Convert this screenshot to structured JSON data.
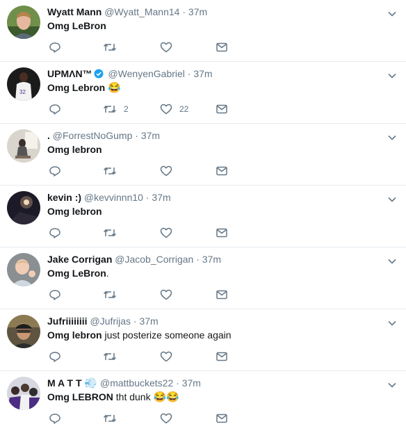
{
  "colors": {
    "text": "#14171a",
    "secondary": "#657786",
    "divider": "#e6ecf0",
    "verified": "#1da1f2"
  },
  "icons": [
    "reply-icon",
    "retweet-icon",
    "like-icon",
    "dm-icon",
    "chevron-down-icon",
    "verified-icon"
  ],
  "tweets": [
    {
      "name": "Wyatt Mann",
      "handle": "@Wyatt_Mann14",
      "time": "37m",
      "text_bold": "Omg LeBron",
      "text_rest": "",
      "emoji": "",
      "retweets": "",
      "likes": ""
    },
    {
      "name": "UPMΛN™",
      "handle": "@WenyenGabriel",
      "time": "37m",
      "text_bold": "Omg Lebron",
      "text_rest": "",
      "emoji": "😂",
      "retweets": "2",
      "likes": "22"
    },
    {
      "name": ".",
      "handle": "@ForrestNoGump",
      "time": "37m",
      "text_bold": "Omg lebron",
      "text_rest": "",
      "emoji": "",
      "retweets": "",
      "likes": ""
    },
    {
      "name": "kevin :)",
      "handle": "@kevvinnn10",
      "time": "37m",
      "text_bold": "Omg lebron",
      "text_rest": "",
      "emoji": "",
      "retweets": "",
      "likes": ""
    },
    {
      "name": "Jake Corrigan",
      "handle": "@Jacob_Corrigan",
      "time": "37m",
      "text_bold": "Omg LeBron",
      "text_rest": ".",
      "emoji": "",
      "retweets": "",
      "likes": ""
    },
    {
      "name": "Jufriiiiiiii",
      "handle": "@Jufrijas",
      "time": "37m",
      "text_bold": "Omg lebron",
      "text_rest": " just posterize someone again",
      "emoji": "",
      "retweets": "",
      "likes": ""
    },
    {
      "name": "M A T T",
      "name_emoji": "💨",
      "handle": "@mattbuckets22",
      "time": "37m",
      "text_bold": "Omg LEBRON",
      "text_rest": " tht dunk ",
      "emoji": "😂😂",
      "retweets": "",
      "likes": ""
    }
  ]
}
